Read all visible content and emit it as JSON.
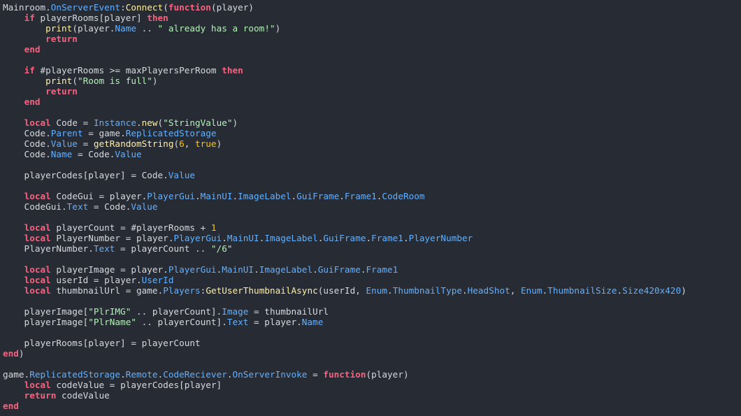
{
  "editor": {
    "lines": [
      [
        [
          "plain",
          "Mainroom."
        ],
        [
          "prop",
          "OnServerEvent"
        ],
        [
          "plain",
          ":"
        ],
        [
          "fn",
          "Connect"
        ],
        [
          "plain",
          "("
        ],
        [
          "kw",
          "function"
        ],
        [
          "plain",
          "(player)"
        ]
      ],
      [
        [
          "plain",
          "    "
        ],
        [
          "kw",
          "if"
        ],
        [
          "plain",
          " playerRooms[player] "
        ],
        [
          "kw",
          "then"
        ]
      ],
      [
        [
          "plain",
          "        "
        ],
        [
          "fn",
          "print"
        ],
        [
          "plain",
          "(player."
        ],
        [
          "prop",
          "Name"
        ],
        [
          "plain",
          " .. "
        ],
        [
          "str",
          "\" already has a room!\""
        ],
        [
          "plain",
          ")"
        ]
      ],
      [
        [
          "plain",
          "        "
        ],
        [
          "kw",
          "return"
        ]
      ],
      [
        [
          "plain",
          "    "
        ],
        [
          "kw",
          "end"
        ]
      ],
      [],
      [
        [
          "plain",
          "    "
        ],
        [
          "kw",
          "if"
        ],
        [
          "plain",
          " #playerRooms >= maxPlayersPerRoom "
        ],
        [
          "kw",
          "then"
        ]
      ],
      [
        [
          "plain",
          "        "
        ],
        [
          "fn",
          "print"
        ],
        [
          "plain",
          "("
        ],
        [
          "str",
          "\"Room is full\""
        ],
        [
          "plain",
          ")"
        ]
      ],
      [
        [
          "plain",
          "        "
        ],
        [
          "kw",
          "return"
        ]
      ],
      [
        [
          "plain",
          "    "
        ],
        [
          "kw",
          "end"
        ]
      ],
      [],
      [
        [
          "plain",
          "    "
        ],
        [
          "kw",
          "local"
        ],
        [
          "plain",
          " Code = "
        ],
        [
          "prop",
          "Instance"
        ],
        [
          "plain",
          "."
        ],
        [
          "fn",
          "new"
        ],
        [
          "plain",
          "("
        ],
        [
          "str",
          "\"StringValue\""
        ],
        [
          "plain",
          ")"
        ]
      ],
      [
        [
          "plain",
          "    Code."
        ],
        [
          "prop",
          "Parent"
        ],
        [
          "plain",
          " = game."
        ],
        [
          "prop",
          "ReplicatedStorage"
        ]
      ],
      [
        [
          "plain",
          "    Code."
        ],
        [
          "prop",
          "Value"
        ],
        [
          "plain",
          " = "
        ],
        [
          "fn",
          "getRandomString"
        ],
        [
          "plain",
          "("
        ],
        [
          "num",
          "6"
        ],
        [
          "plain",
          ", "
        ],
        [
          "bool",
          "true"
        ],
        [
          "plain",
          ")"
        ]
      ],
      [
        [
          "plain",
          "    Code."
        ],
        [
          "prop",
          "Name"
        ],
        [
          "plain",
          " = Code."
        ],
        [
          "prop",
          "Value"
        ]
      ],
      [],
      [
        [
          "plain",
          "    playerCodes[player] = Code."
        ],
        [
          "prop",
          "Value"
        ]
      ],
      [],
      [
        [
          "plain",
          "    "
        ],
        [
          "kw",
          "local"
        ],
        [
          "plain",
          " CodeGui = player."
        ],
        [
          "prop",
          "PlayerGui"
        ],
        [
          "plain",
          "."
        ],
        [
          "prop",
          "MainUI"
        ],
        [
          "plain",
          "."
        ],
        [
          "prop",
          "ImageLabel"
        ],
        [
          "plain",
          "."
        ],
        [
          "prop",
          "GuiFrame"
        ],
        [
          "plain",
          "."
        ],
        [
          "prop",
          "Frame1"
        ],
        [
          "plain",
          "."
        ],
        [
          "prop",
          "CodeRoom"
        ]
      ],
      [
        [
          "plain",
          "    CodeGui."
        ],
        [
          "prop",
          "Text"
        ],
        [
          "plain",
          " = Code."
        ],
        [
          "prop",
          "Value"
        ]
      ],
      [],
      [
        [
          "plain",
          "    "
        ],
        [
          "kw",
          "local"
        ],
        [
          "plain",
          " playerCount = #playerRooms + "
        ],
        [
          "num",
          "1"
        ]
      ],
      [
        [
          "plain",
          "    "
        ],
        [
          "kw",
          "local"
        ],
        [
          "plain",
          " PlayerNumber = player."
        ],
        [
          "prop",
          "PlayerGui"
        ],
        [
          "plain",
          "."
        ],
        [
          "prop",
          "MainUI"
        ],
        [
          "plain",
          "."
        ],
        [
          "prop",
          "ImageLabel"
        ],
        [
          "plain",
          "."
        ],
        [
          "prop",
          "GuiFrame"
        ],
        [
          "plain",
          "."
        ],
        [
          "prop",
          "Frame1"
        ],
        [
          "plain",
          "."
        ],
        [
          "prop",
          "PlayerNumber"
        ]
      ],
      [
        [
          "plain",
          "    PlayerNumber."
        ],
        [
          "prop",
          "Text"
        ],
        [
          "plain",
          " = playerCount .. "
        ],
        [
          "str",
          "\"/6\""
        ]
      ],
      [],
      [
        [
          "plain",
          "    "
        ],
        [
          "kw",
          "local"
        ],
        [
          "plain",
          " playerImage = player."
        ],
        [
          "prop",
          "PlayerGui"
        ],
        [
          "plain",
          "."
        ],
        [
          "prop",
          "MainUI"
        ],
        [
          "plain",
          "."
        ],
        [
          "prop",
          "ImageLabel"
        ],
        [
          "plain",
          "."
        ],
        [
          "prop",
          "GuiFrame"
        ],
        [
          "plain",
          "."
        ],
        [
          "prop",
          "Frame1"
        ]
      ],
      [
        [
          "plain",
          "    "
        ],
        [
          "kw",
          "local"
        ],
        [
          "plain",
          " userId = player."
        ],
        [
          "prop",
          "UserId"
        ]
      ],
      [
        [
          "plain",
          "    "
        ],
        [
          "kw",
          "local"
        ],
        [
          "plain",
          " thumbnailUrl = game."
        ],
        [
          "prop",
          "Players"
        ],
        [
          "plain",
          ":"
        ],
        [
          "fn",
          "GetUserThumbnailAsync"
        ],
        [
          "plain",
          "(userId, "
        ],
        [
          "prop",
          "Enum"
        ],
        [
          "plain",
          "."
        ],
        [
          "prop",
          "ThumbnailType"
        ],
        [
          "plain",
          "."
        ],
        [
          "prop",
          "HeadShot"
        ],
        [
          "plain",
          ", "
        ],
        [
          "prop",
          "Enum"
        ],
        [
          "plain",
          "."
        ],
        [
          "prop",
          "ThumbnailSize"
        ],
        [
          "plain",
          "."
        ],
        [
          "prop",
          "Size420x420"
        ],
        [
          "plain",
          ")"
        ]
      ],
      [],
      [
        [
          "plain",
          "    playerImage["
        ],
        [
          "str",
          "\"PlrIMG\""
        ],
        [
          "plain",
          " .. playerCount]."
        ],
        [
          "prop",
          "Image"
        ],
        [
          "plain",
          " = thumbnailUrl"
        ]
      ],
      [
        [
          "plain",
          "    playerImage["
        ],
        [
          "str",
          "\"PlrName\""
        ],
        [
          "plain",
          " .. playerCount]."
        ],
        [
          "prop",
          "Text"
        ],
        [
          "plain",
          " = player."
        ],
        [
          "prop",
          "Name"
        ]
      ],
      [],
      [
        [
          "plain",
          "    playerRooms[player] = playerCount"
        ]
      ],
      [
        [
          "kw",
          "end"
        ],
        [
          "plain",
          ")"
        ]
      ],
      [],
      [
        [
          "plain",
          "game."
        ],
        [
          "prop",
          "ReplicatedStorage"
        ],
        [
          "plain",
          "."
        ],
        [
          "prop",
          "Remote"
        ],
        [
          "plain",
          "."
        ],
        [
          "prop",
          "CodeReciever"
        ],
        [
          "plain",
          "."
        ],
        [
          "prop",
          "OnServerInvoke"
        ],
        [
          "plain",
          " = "
        ],
        [
          "kw",
          "function"
        ],
        [
          "plain",
          "(player)"
        ]
      ],
      [
        [
          "plain",
          "    "
        ],
        [
          "kw",
          "local"
        ],
        [
          "plain",
          " codeValue = playerCodes[player]"
        ]
      ],
      [
        [
          "plain",
          "    "
        ],
        [
          "kw",
          "return"
        ],
        [
          "plain",
          " codeValue"
        ]
      ],
      [
        [
          "kw",
          "end"
        ]
      ]
    ]
  }
}
